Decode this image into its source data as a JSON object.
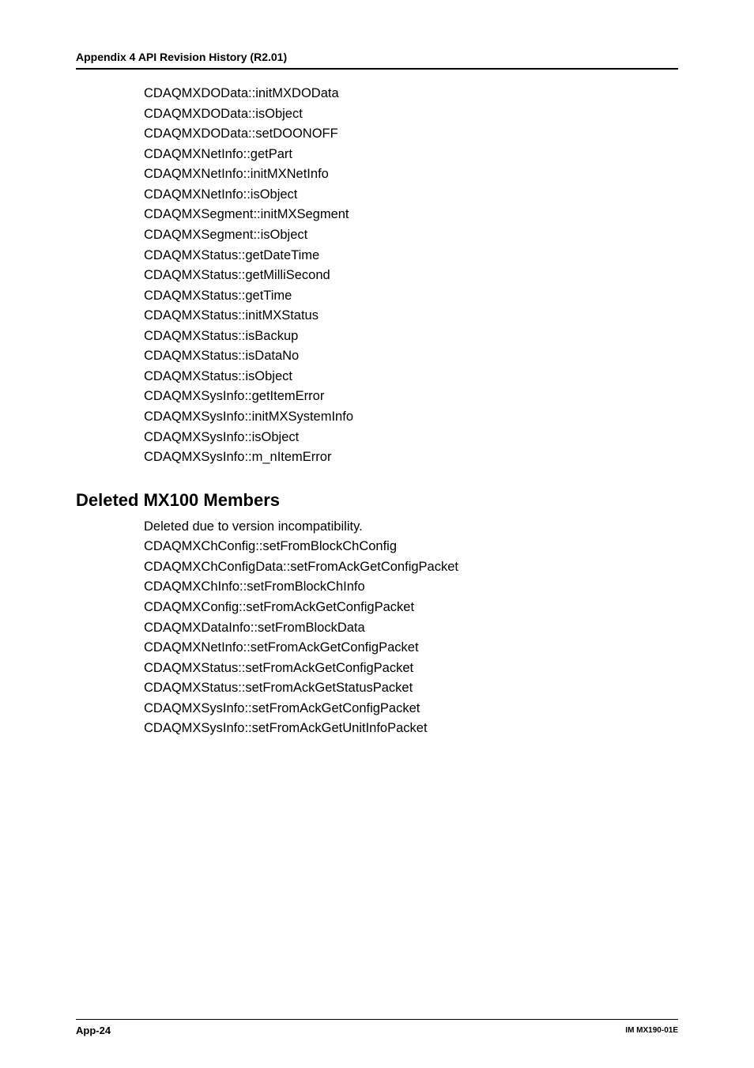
{
  "header": "Appendix 4  API Revision History (R2.01)",
  "apiList": [
    "CDAQMXDOData::initMXDOData",
    "CDAQMXDOData::isObject",
    "CDAQMXDOData::setDOONOFF",
    "CDAQMXNetInfo::getPart",
    "CDAQMXNetInfo::initMXNetInfo",
    "CDAQMXNetInfo::isObject",
    "CDAQMXSegment::initMXSegment",
    "CDAQMXSegment::isObject",
    "CDAQMXStatus::getDateTime",
    "CDAQMXStatus::getMilliSecond",
    "CDAQMXStatus::getTime",
    "CDAQMXStatus::initMXStatus",
    "CDAQMXStatus::isBackup",
    "CDAQMXStatus::isDataNo",
    "CDAQMXStatus::isObject",
    "CDAQMXSysInfo::getItemError",
    "CDAQMXSysInfo::initMXSystemInfo",
    "CDAQMXSysInfo::isObject",
    "CDAQMXSysInfo::m_nItemError"
  ],
  "sectionHeading": "Deleted MX100 Members",
  "deletedIntro": "Deleted due to version incompatibility.",
  "deletedList": [
    "CDAQMXChConfig::setFromBlockChConfig",
    "CDAQMXChConfigData::setFromAckGetConfigPacket",
    "CDAQMXChInfo::setFromBlockChInfo",
    "CDAQMXConfig::setFromAckGetConfigPacket",
    "CDAQMXDataInfo::setFromBlockData",
    "CDAQMXNetInfo::setFromAckGetConfigPacket",
    "CDAQMXStatus::setFromAckGetConfigPacket",
    "CDAQMXStatus::setFromAckGetStatusPacket",
    "CDAQMXSysInfo::setFromAckGetConfigPacket",
    "CDAQMXSysInfo::setFromAckGetUnitInfoPacket"
  ],
  "footer": {
    "pageLabel": "App-24",
    "docId": "IM MX190-01E"
  }
}
